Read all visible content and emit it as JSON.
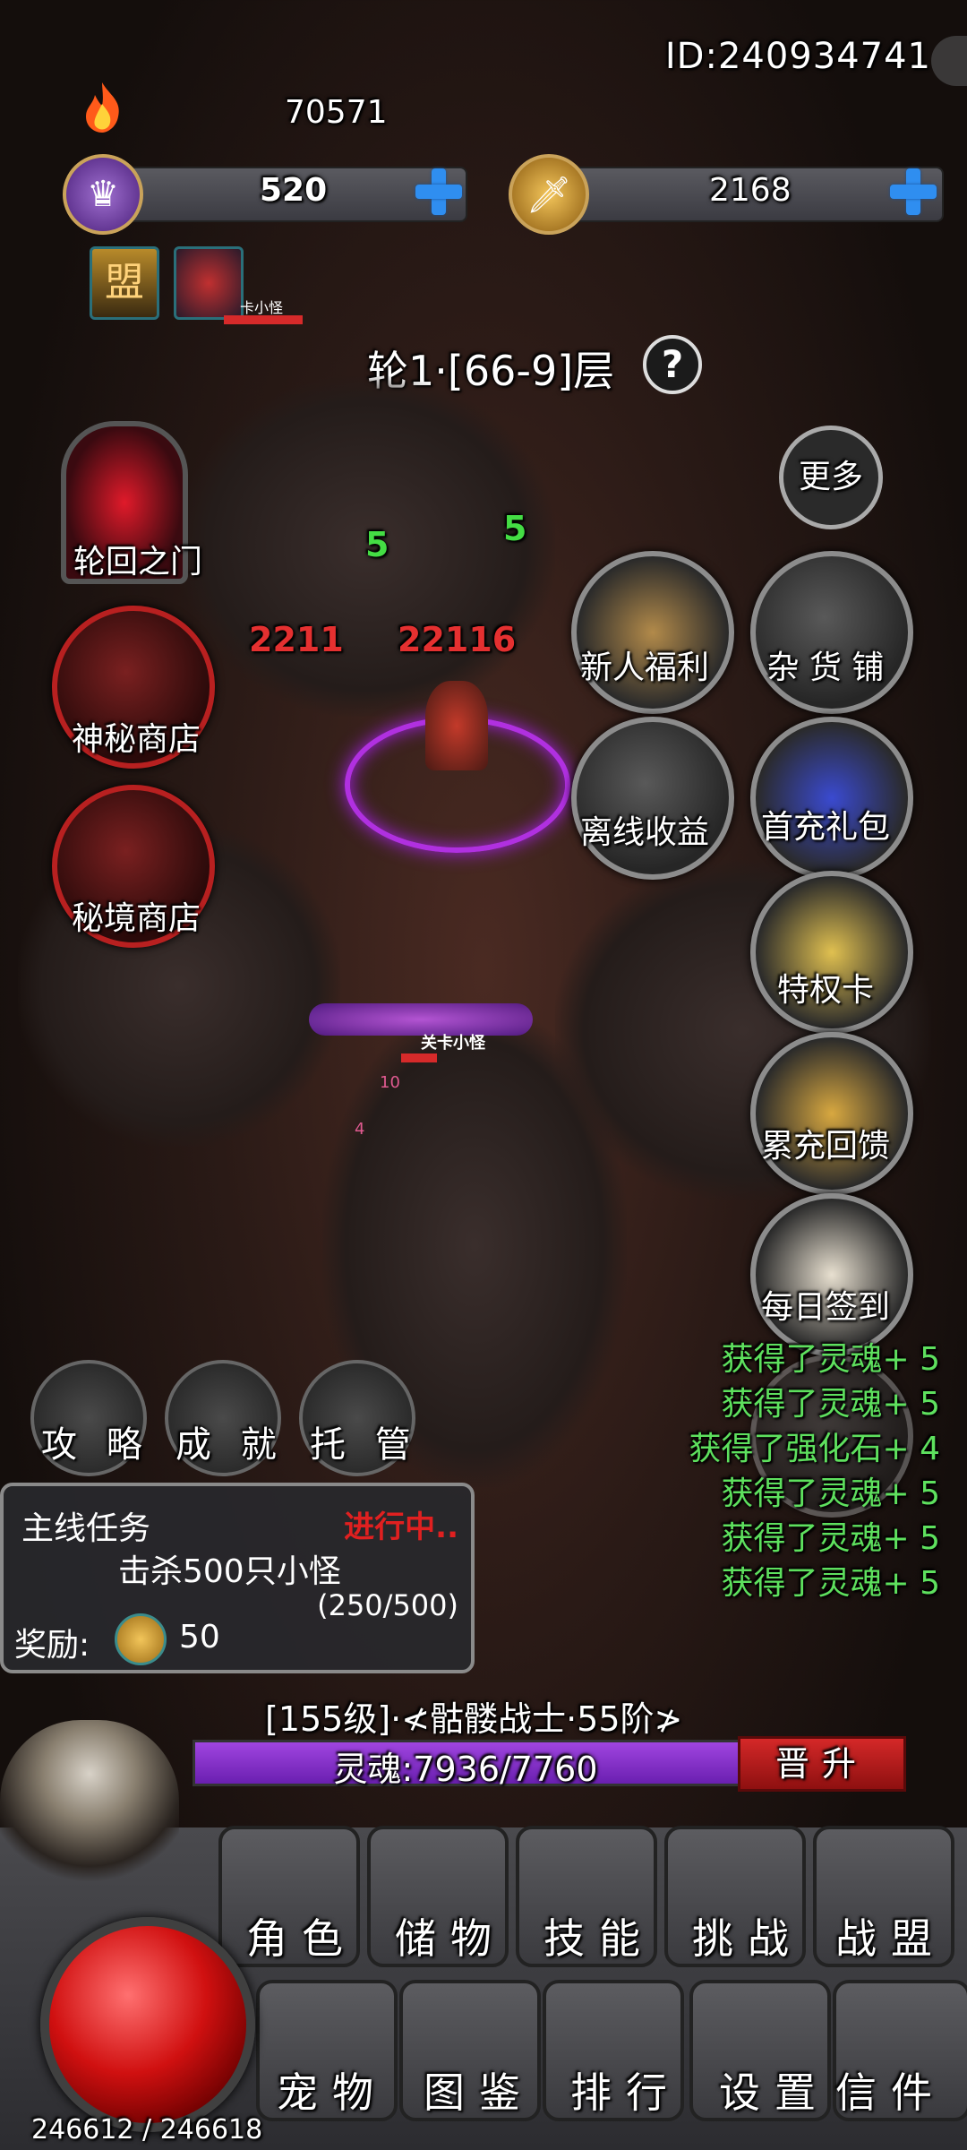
{
  "top": {
    "user_id": "ID:240934741",
    "power": "70571",
    "crown_currency": "520",
    "gold_currency": "2168",
    "mini_icon_label": "卡小怪"
  },
  "floor": {
    "label": "轮1·[66-9]层",
    "help": "?"
  },
  "left_menu": {
    "portal": "轮回之门",
    "mystic_shop": "神秘商店",
    "secret_shop": "秘境商店"
  },
  "right_menu": {
    "more": "更多",
    "newbie": "新人福利",
    "grocery": "杂 货 铺",
    "offline": "离线收益",
    "first_charge": "首充礼包",
    "privilege": "特权卡",
    "cumulative": "累充回馈",
    "daily_sign": "每日签到"
  },
  "battle": {
    "damage_left": "2211",
    "damage_right": "22116",
    "gain_left": "5",
    "gain_right": "5",
    "enemy_name": "关卡小怪",
    "hit1": "10",
    "hit2": "4"
  },
  "log": [
    "获得了灵魂+ 5",
    "获得了灵魂+ 5",
    "获得了强化石+ 4",
    "获得了灵魂+ 5",
    "获得了灵魂+ 5",
    "获得了灵魂+ 5"
  ],
  "small_buttons": {
    "guide": "攻 略",
    "achievement": "成 就",
    "auto": "托 管"
  },
  "task": {
    "title": "主线任务",
    "status": "进行中..",
    "desc": "击杀500只小怪",
    "progress": "(250/500)",
    "reward_label": "奖励:",
    "reward_value": "50"
  },
  "player": {
    "level": "[155级]·≮骷髅战士·55阶≯",
    "soul": "灵魂:7936/7760",
    "soul_fill_pct": 100,
    "promote": "晋升",
    "hp": "246612 / 246618"
  },
  "nav_row1": [
    "角色",
    "储物",
    "技能",
    "挑战",
    "战盟"
  ],
  "nav_row2": [
    "宠物",
    "图鉴",
    "排行",
    "设置",
    "信件"
  ],
  "colors": {
    "log_green": "#5ee05e",
    "damage_red": "#e53030",
    "soul_purple": "#a045e0",
    "plus_blue": "#2f8ef0"
  }
}
